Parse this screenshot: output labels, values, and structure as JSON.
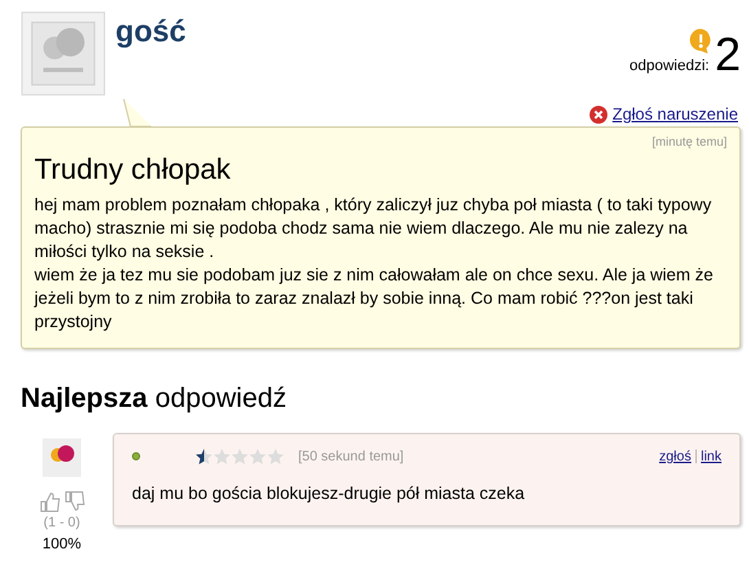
{
  "question": {
    "author": "gość",
    "answers_label": "odpowiedzi:",
    "answers_count": "2",
    "report_link": "Zgłoś naruszenie",
    "time": "[minutę temu]",
    "title": "Trudny chłopak",
    "body": [
      "hej mam problem poznałam chłopaka , który zaliczył juz chyba poł miasta ( to taki typowy macho) strasznie mi się podoba chodz sama nie wiem dlaczego. Ale mu nie zalezy na miłości tylko na seksie .",
      "wiem że ja tez mu sie podobam juz sie z nim całowałam ale on chce sexu. Ale ja wiem że jeżeli bym to z nim zrobiła to zaraz znalazł by sobie inną. Co mam robić ???on jest taki przystojny"
    ]
  },
  "best_answer": {
    "heading_bold": "Najlepsza",
    "heading_rest": "odpowiedź",
    "online": true,
    "stars": 0.5,
    "time": "[50 sekund temu]",
    "report_link": "zgłoś",
    "link": "link",
    "text": "daj mu bo gościa blokujesz-drugie pół miasta czeka",
    "votes": "(1 - 0)",
    "percent": "100%"
  }
}
